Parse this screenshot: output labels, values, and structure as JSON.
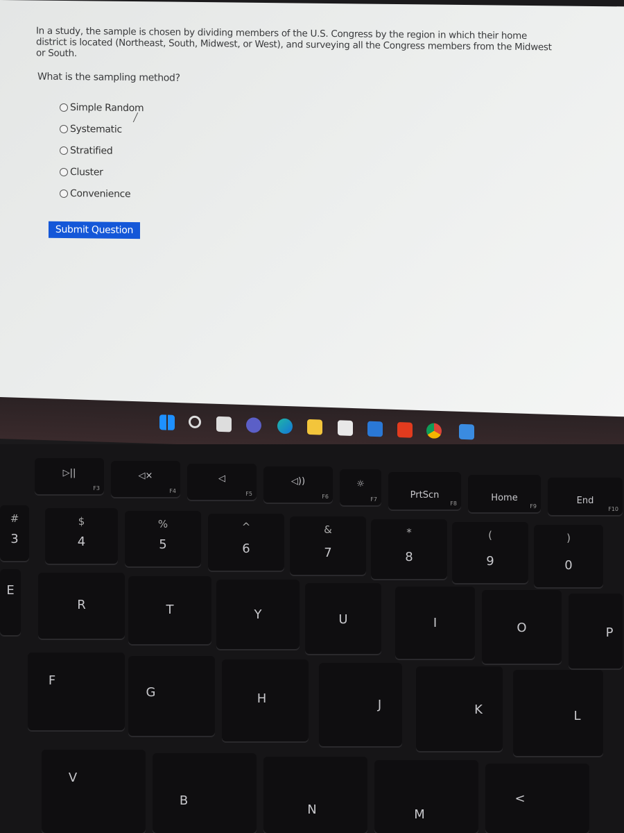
{
  "question": {
    "text": "In a study, the sample is chosen by dividing members of the U.S. Congress by the region in which their home district is located (Northeast, South, Midwest, or West), and surveying all the Congress members from the Midwest or South.",
    "prompt": "What is the sampling method?",
    "options": [
      "Simple Random",
      "Systematic",
      "Stratified",
      "Cluster",
      "Convenience"
    ],
    "submit_label": "Submit Question"
  },
  "taskbar": {
    "icons": [
      "windows-start",
      "search",
      "task-view",
      "meet",
      "edge",
      "file-explorer",
      "store",
      "mail",
      "office",
      "chrome",
      "photos"
    ]
  },
  "keyboard": {
    "fn_row": [
      {
        "main": "▷||",
        "sub": "F3"
      },
      {
        "main": "◁×",
        "sub": "F4"
      },
      {
        "main": "◁",
        "sub": "F5"
      },
      {
        "main": "◁))",
        "sub": "F6"
      },
      {
        "main": "☼",
        "sub": "F7"
      },
      {
        "main": "PrtScn",
        "sub": "F8"
      },
      {
        "main": "Home",
        "sub": "F9"
      },
      {
        "main": "End",
        "sub": "F10"
      }
    ],
    "num_row": [
      {
        "top": "#",
        "main": "3"
      },
      {
        "top": "$",
        "main": "4"
      },
      {
        "top": "%",
        "main": "5"
      },
      {
        "top": "^",
        "main": "6"
      },
      {
        "top": "&",
        "main": "7"
      },
      {
        "top": "*",
        "main": "8"
      },
      {
        "top": "(",
        "main": "9"
      },
      {
        "top": ")",
        "main": "0"
      }
    ],
    "row_q": [
      "E",
      "R",
      "T",
      "Y",
      "U",
      "I",
      "O",
      "P"
    ],
    "row_a": [
      "F",
      "G",
      "H",
      "J",
      "K",
      "L"
    ],
    "row_z": [
      "V",
      "B",
      "N",
      "M",
      "<"
    ]
  }
}
